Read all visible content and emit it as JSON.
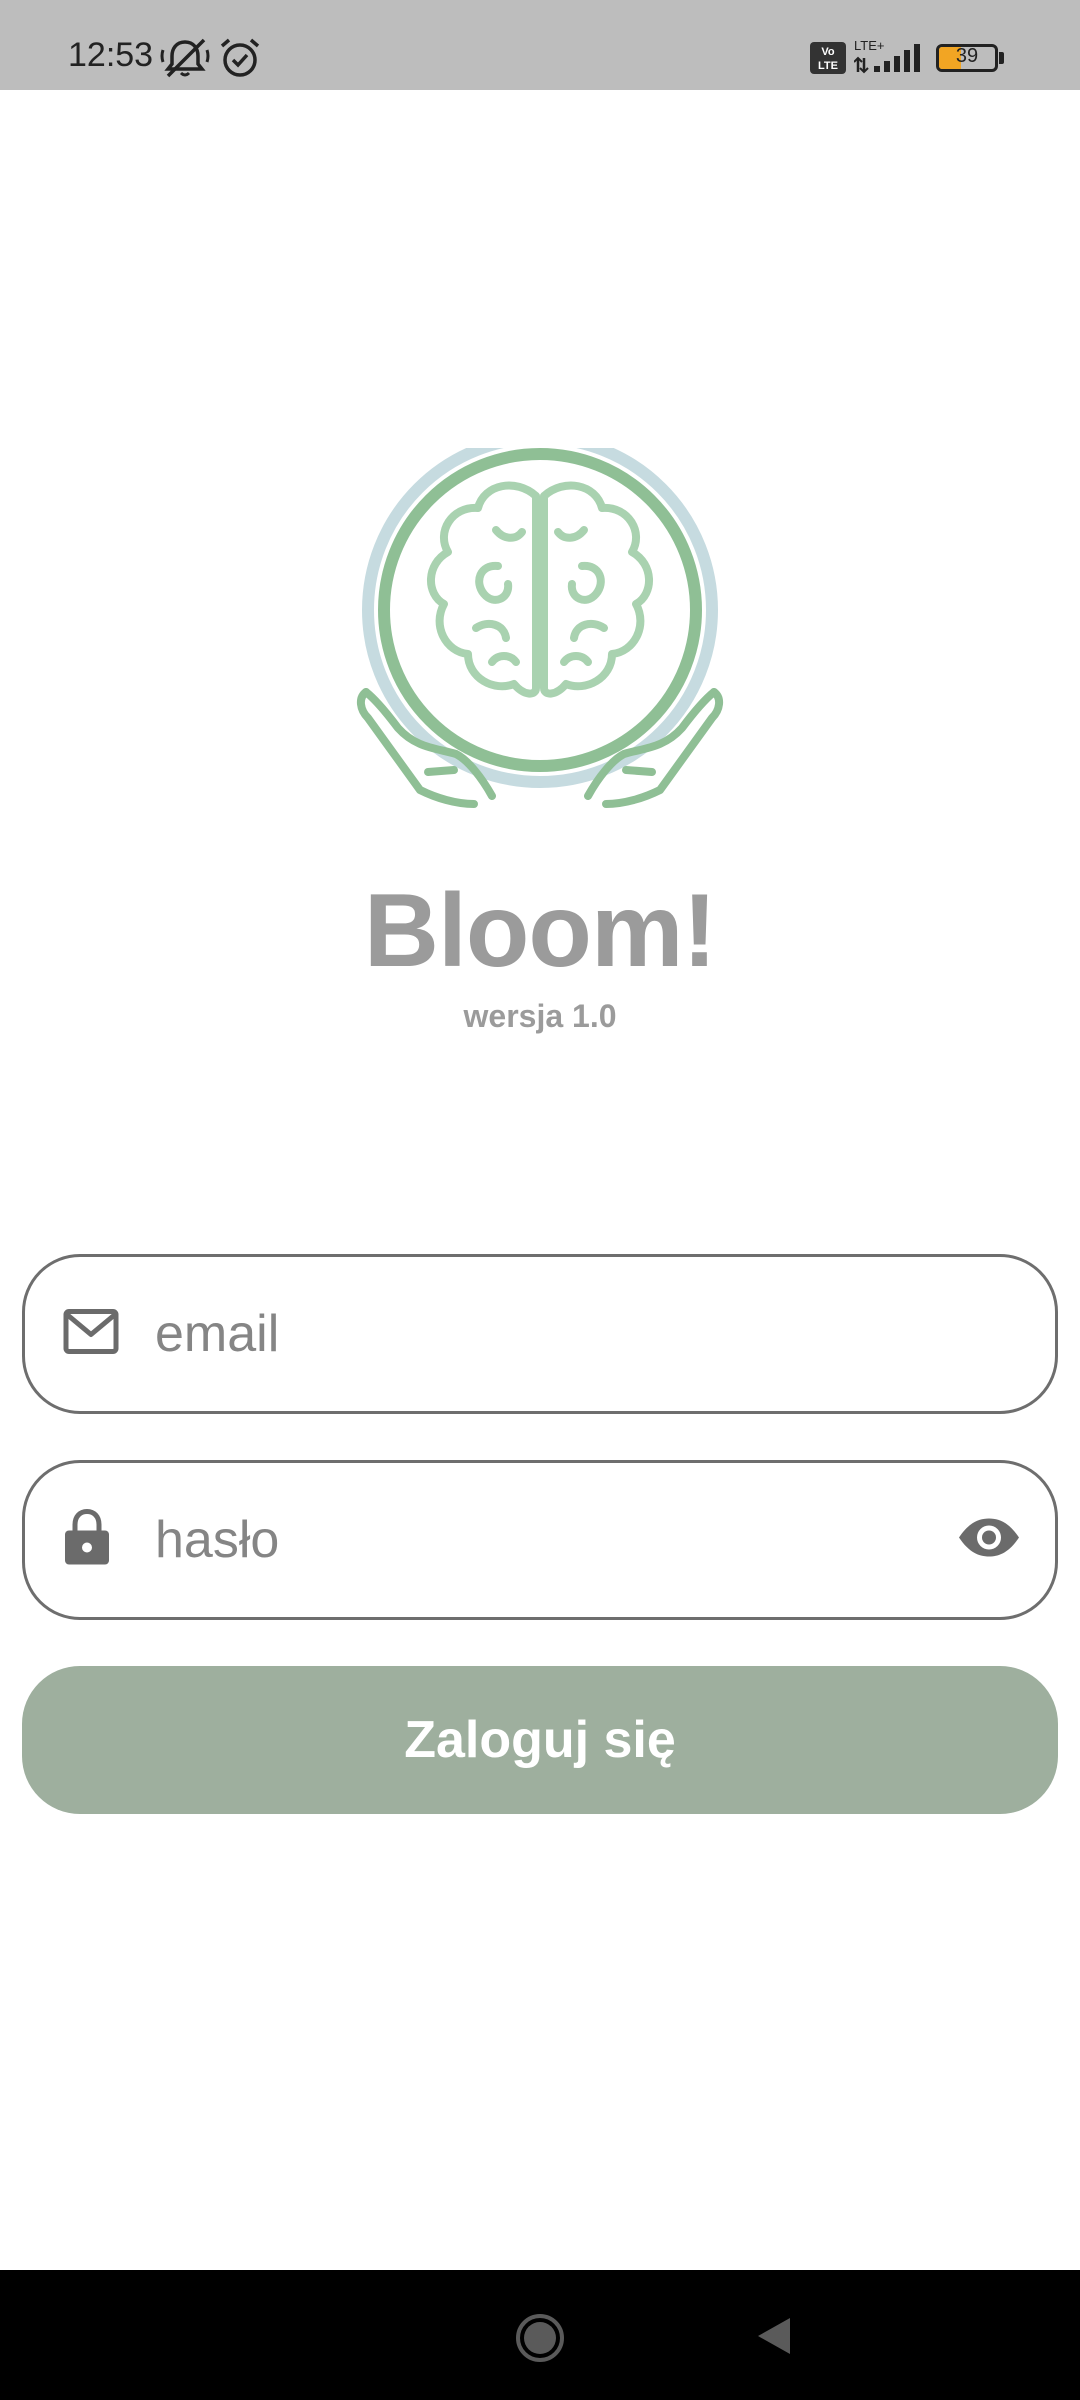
{
  "status_bar": {
    "time": "12:53",
    "icons": [
      "mute-icon",
      "alarm-icon",
      "volte-icon",
      "signal-icon"
    ],
    "network": "LTE+",
    "volte": "Vo LTE",
    "battery_percent": "39",
    "battery_color": "#f2a523"
  },
  "app": {
    "logo": "brain-in-hands-logo",
    "title": "Bloom!",
    "version": "wersja 1.0"
  },
  "login_form": {
    "email": {
      "icon": "mail-icon",
      "placeholder": "email",
      "value": ""
    },
    "password": {
      "icon": "lock-icon",
      "placeholder": "hasło",
      "value": "",
      "toggle_icon": "eye-icon"
    },
    "submit_label": "Zaloguj się",
    "submit_color": "#9eaf9e"
  },
  "nav_bar": {
    "icons": [
      "home-icon",
      "back-icon"
    ]
  }
}
